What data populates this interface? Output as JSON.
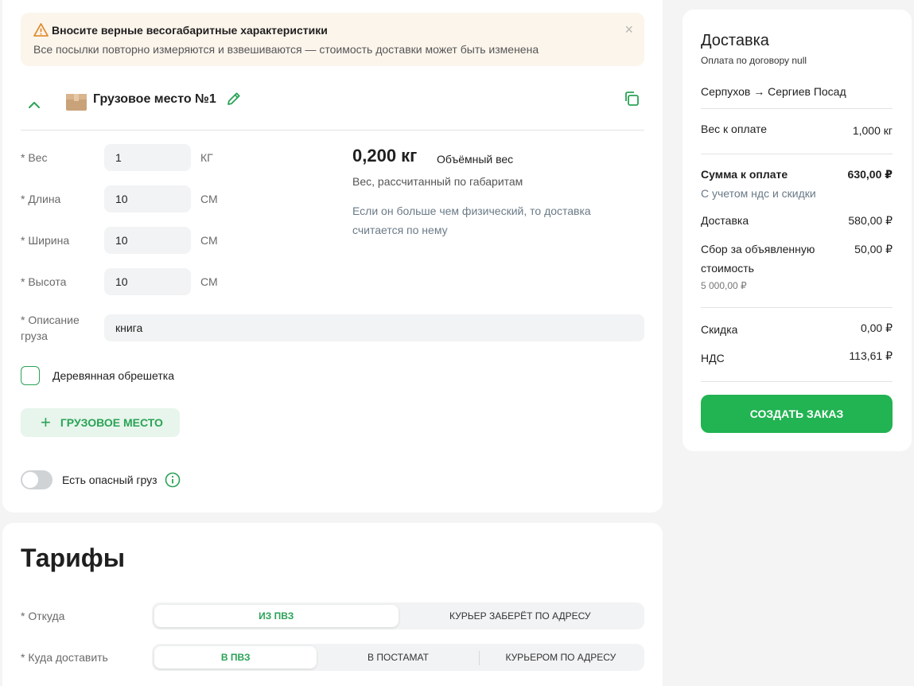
{
  "warning": {
    "title": "Вносите верные весогабаритные характеристики",
    "text": "Все посылки повторно измеряются и взвешиваются — стоимость доставки может быть изменена",
    "close": "×"
  },
  "cargo": {
    "title": "Грузовое место №1",
    "fields": [
      {
        "label": "Вес",
        "value": "1",
        "unit": "КГ"
      },
      {
        "label": "Длина",
        "value": "10",
        "unit": "СМ"
      },
      {
        "label": "Ширина",
        "value": "10",
        "unit": "СМ"
      },
      {
        "label": "Высота",
        "value": "10",
        "unit": "СМ"
      }
    ],
    "description": {
      "label": "Описание груза",
      "value": "книга"
    },
    "required_mark": "*",
    "volume": {
      "value": "0,200 кг",
      "label": "Объёмный вес",
      "sub": "Вес, рассчитанный по габаритам",
      "note": "Если он больше чем физический, то доставка считается по нему"
    },
    "wooden_crate_label": "Деревянная обрешетка",
    "add_button_label": "ГРУЗОВОЕ МЕСТО",
    "dangerous_label": "Есть опасный груз"
  },
  "tariffs": {
    "title": "Тарифы",
    "from": {
      "label": "Откуда",
      "options": [
        "ИЗ ПВЗ",
        "КУРЬЕР ЗАБЕРЁТ ПО АДРЕСУ"
      ],
      "selected": 0
    },
    "to": {
      "label": "Куда доставить",
      "options": [
        "В ПВЗ",
        "В ПОСТАМАТ",
        "КУРЬЕРОМ ПО АДРЕСУ"
      ],
      "selected": 0
    }
  },
  "summary": {
    "title": "Доставка",
    "subtitle": "Оплата по договору null",
    "route": "Серпухов → Сергиев Посад",
    "weight_label": "Вес к оплате",
    "weight_value": "1,000 кг",
    "total_label": "Сумма к оплате",
    "total_value": "630,00 ₽",
    "total_note": "С учетом ндс и скидки",
    "delivery_label": "Доставка",
    "delivery_value": "580,00 ₽",
    "declared_label": "Сбор за объявленную стоимость",
    "declared_value": "50,00 ₽",
    "declared_amount": "5 000,00 ₽",
    "discount_label": "Скидка",
    "discount_value": "0,00 ₽",
    "vat_label": "НДС",
    "vat_value": "113,61 ₽",
    "create_button": "СОЗДАТЬ ЗАКАЗ"
  },
  "colors": {
    "accent": "#22b352",
    "warning_bg": "#fcf5ec",
    "warning_icon": "#e08a2c"
  }
}
